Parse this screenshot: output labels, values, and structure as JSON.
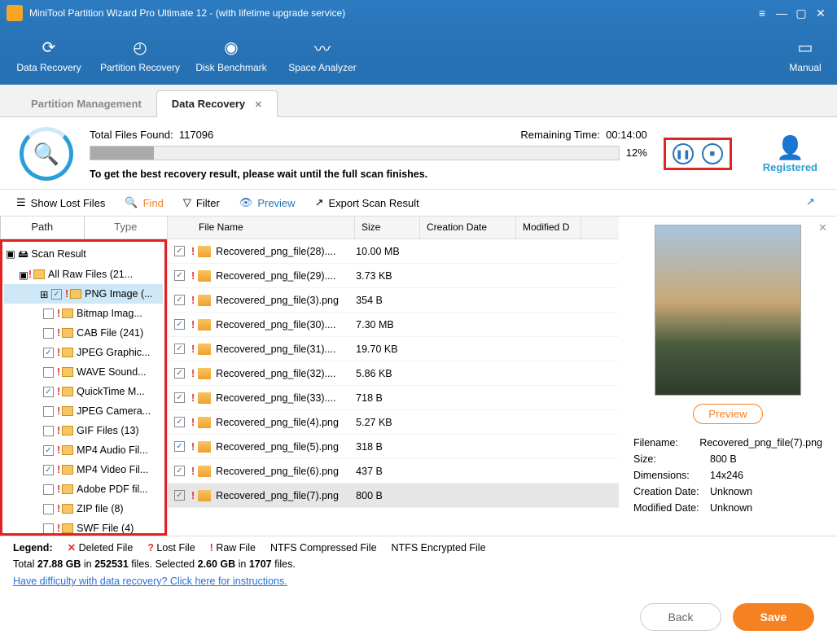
{
  "window": {
    "title": "MiniTool Partition Wizard Pro Ultimate 12 - (with lifetime upgrade service)"
  },
  "toolbar": {
    "data_recovery": "Data Recovery",
    "partition_recovery": "Partition Recovery",
    "disk_benchmark": "Disk Benchmark",
    "space_analyzer": "Space Analyzer",
    "manual": "Manual"
  },
  "tabs": {
    "partition_management": "Partition Management",
    "data_recovery": "Data Recovery"
  },
  "scan": {
    "total_label": "Total Files Found:",
    "total_value": "117096",
    "remaining_label": "Remaining Time:",
    "remaining_value": "00:14:00",
    "percent": "12%",
    "hint": "To get the best recovery result, please wait until the full scan finishes.",
    "registered": "Registered"
  },
  "actions": {
    "show_lost": "Show Lost Files",
    "find": "Find",
    "filter": "Filter",
    "preview": "Preview",
    "export": "Export Scan Result"
  },
  "subtabs": {
    "path": "Path",
    "type": "Type"
  },
  "tree": {
    "root": "Scan Result",
    "all_raw": "All Raw Files (21...",
    "items": [
      {
        "label": "PNG Image (...",
        "checked": true,
        "selected": true,
        "expand": true
      },
      {
        "label": "Bitmap Imag...",
        "checked": false
      },
      {
        "label": "CAB File (241)",
        "checked": false
      },
      {
        "label": "JPEG Graphic...",
        "checked": true
      },
      {
        "label": "WAVE Sound...",
        "checked": false
      },
      {
        "label": "QuickTime M...",
        "checked": true
      },
      {
        "label": "JPEG Camera...",
        "checked": false
      },
      {
        "label": "GIF Files (13)",
        "checked": false
      },
      {
        "label": "MP4 Audio Fil...",
        "checked": true
      },
      {
        "label": "MP4 Video Fil...",
        "checked": true
      },
      {
        "label": "Adobe PDF fil...",
        "checked": false
      },
      {
        "label": "ZIP file (8)",
        "checked": false
      },
      {
        "label": "SWF File (4)",
        "checked": false
      }
    ]
  },
  "columns": {
    "name": "File Name",
    "size": "Size",
    "cd": "Creation Date",
    "md": "Modified D"
  },
  "files": [
    {
      "name": "Recovered_png_file(28)....",
      "size": "10.00 MB"
    },
    {
      "name": "Recovered_png_file(29)....",
      "size": "3.73 KB"
    },
    {
      "name": "Recovered_png_file(3).png",
      "size": "354 B"
    },
    {
      "name": "Recovered_png_file(30)....",
      "size": "7.30 MB"
    },
    {
      "name": "Recovered_png_file(31)....",
      "size": "19.70 KB"
    },
    {
      "name": "Recovered_png_file(32)....",
      "size": "5.86 KB"
    },
    {
      "name": "Recovered_png_file(33)....",
      "size": "718 B"
    },
    {
      "name": "Recovered_png_file(4).png",
      "size": "5.27 KB"
    },
    {
      "name": "Recovered_png_file(5).png",
      "size": "318 B"
    },
    {
      "name": "Recovered_png_file(6).png",
      "size": "437 B"
    },
    {
      "name": "Recovered_png_file(7).png",
      "size": "800 B",
      "selected": true
    }
  ],
  "preview": {
    "button": "Preview",
    "filename_label": "Filename:",
    "filename": "Recovered_png_file(7).png",
    "size_label": "Size:",
    "size": "800 B",
    "dim_label": "Dimensions:",
    "dim": "14x246",
    "cd_label": "Creation Date:",
    "cd": "Unknown",
    "md_label": "Modified Date:",
    "md": "Unknown"
  },
  "legend": {
    "label": "Legend:",
    "deleted": "Deleted File",
    "lost": "Lost File",
    "raw": "Raw File",
    "ntfs_c": "NTFS Compressed File",
    "ntfs_e": "NTFS Encrypted File"
  },
  "stats": {
    "total_size": "27.88 GB",
    "total_files": "252531",
    "sel_size": "2.60 GB",
    "sel_files": "1707",
    "t1": "Total ",
    "t2": " in ",
    "t3": " files.  Selected ",
    "t4": " in ",
    "t5": " files."
  },
  "help_link": "Have difficulty with data recovery? Click here for instructions.",
  "footer": {
    "back": "Back",
    "save": "Save"
  }
}
